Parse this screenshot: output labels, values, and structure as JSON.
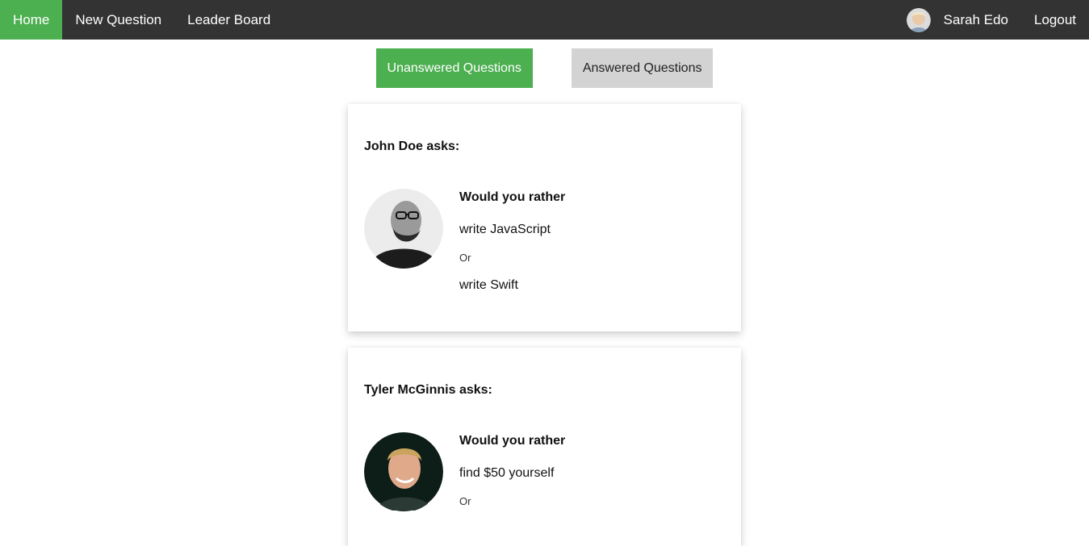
{
  "nav": {
    "home": "Home",
    "new_question": "New Question",
    "leader_board": "Leader Board",
    "user_name": "Sarah Edo",
    "logout": "Logout",
    "active_color": "#4caf50",
    "bg_color": "#333333"
  },
  "tabs": {
    "unanswered": "Unanswered Questions",
    "answered": "Answered Questions"
  },
  "questions": [
    {
      "asker": "John Doe asks:",
      "title": "Would you rather",
      "option_one": "write JavaScript",
      "or": "Or",
      "option_two": "write Swift"
    },
    {
      "asker": "Tyler McGinnis asks:",
      "title": "Would you rather",
      "option_one": "find $50 yourself",
      "or": "Or",
      "option_two": ""
    }
  ]
}
